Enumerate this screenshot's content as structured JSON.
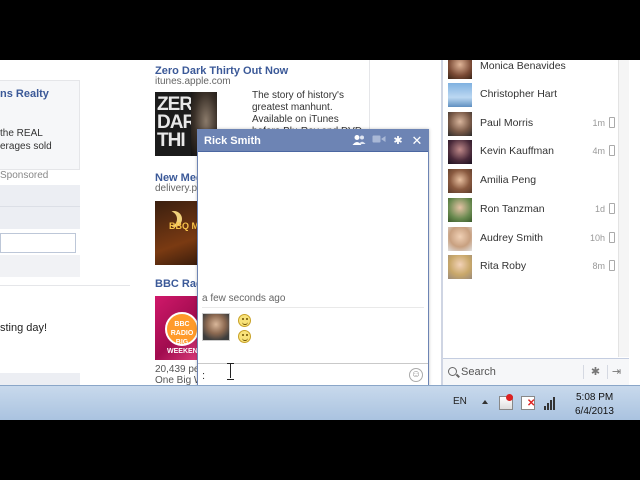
{
  "left": {
    "realty_title": "ns Realty",
    "realty_line1": "the REAL",
    "realty_line2": "erages sold",
    "sponsored": "Sponsored",
    "post_text": "sting day!"
  },
  "ads": [
    {
      "title": "Zero Dark Thirty Out Now",
      "url": "itunes.apple.com",
      "image_text": "ZERO DARK THI",
      "text_lines": [
        "The story of history's",
        "greatest manhunt.",
        "Available on iTunes",
        "before Blu-Ray and DVD"
      ]
    },
    {
      "title": "New Meg",
      "url": "delivery.p",
      "image_text": "BBQ ME"
    },
    {
      "title": "BBC Rad",
      "footer1": "20,439 pe",
      "footer2": "One Big W",
      "image_text": "BBC RADIO BIG WEEKEND"
    }
  ],
  "chat": {
    "title": "Rick Smith",
    "timestamp": "a few seconds ago",
    "input_value": ":",
    "icons": {
      "add_friends": "add-friends-icon",
      "video_call": "video-call-icon",
      "settings": "gear-icon",
      "close": "close-icon",
      "emoji": "emoji-icon"
    }
  },
  "sidebar": {
    "friends": [
      {
        "name": "Monica Benavides",
        "time": ""
      },
      {
        "name": "Christopher Hart",
        "time": ""
      },
      {
        "name": "Paul Morris",
        "time": "1m"
      },
      {
        "name": "Kevin Kauffman",
        "time": "4m"
      },
      {
        "name": "Amilia Peng",
        "time": ""
      },
      {
        "name": "Ron Tanzman",
        "time": "1d"
      },
      {
        "name": "Audrey Smith",
        "time": "10h"
      },
      {
        "name": "Rita Roby",
        "time": "8m"
      }
    ],
    "search_placeholder": "Search"
  },
  "taskbar": {
    "language": "EN",
    "time": "5:08 PM",
    "date": "6/4/2013"
  },
  "colors": {
    "facebook_blue": "#3b5998",
    "chat_header": "#6d84b4"
  }
}
